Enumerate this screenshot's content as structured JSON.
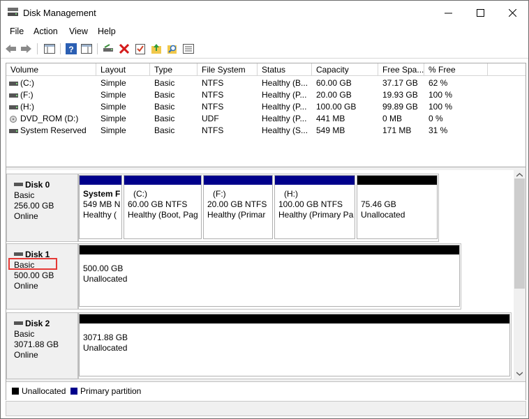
{
  "window": {
    "title": "Disk Management"
  },
  "menu": [
    "File",
    "Action",
    "View",
    "Help"
  ],
  "toolbar": {
    "icons": [
      "back-icon",
      "forward-icon",
      "console-tree-icon",
      "help-icon",
      "show-hide-icon",
      "connect-drive-icon",
      "delete-icon",
      "properties-icon",
      "up-folder-icon",
      "search-icon",
      "list-icon"
    ]
  },
  "volumes": {
    "columns": [
      "Volume",
      "Layout",
      "Type",
      "File System",
      "Status",
      "Capacity",
      "Free Spa...",
      "% Free"
    ],
    "rows": [
      [
        "(C:)",
        "Simple",
        "Basic",
        "NTFS",
        "Healthy (B...",
        "60.00 GB",
        "37.17 GB",
        "62 %"
      ],
      [
        "(F:)",
        "Simple",
        "Basic",
        "NTFS",
        "Healthy (P...",
        "20.00 GB",
        "19.93 GB",
        "100 %"
      ],
      [
        "(H:)",
        "Simple",
        "Basic",
        "NTFS",
        "Healthy (P...",
        "100.00 GB",
        "99.89 GB",
        "100 %"
      ],
      [
        "DVD_ROM (D:)",
        "Simple",
        "Basic",
        "UDF",
        "Healthy (P...",
        "441 MB",
        "0 MB",
        "0 %"
      ],
      [
        "System Reserved",
        "Simple",
        "Basic",
        "NTFS",
        "Healthy (S...",
        "549 MB",
        "171 MB",
        "31 %"
      ]
    ]
  },
  "disks": [
    {
      "name": "Disk 0",
      "type": "Basic",
      "size": "256.00 GB",
      "state": "Online",
      "partitions": [
        {
          "l1": "System F",
          "l2": "549 MB N",
          "l3": "Healthy (",
          "bold": true
        },
        {
          "l1": "(C:)",
          "l2": "60.00 GB NTFS",
          "l3": "Healthy (Boot, Pag"
        },
        {
          "l1": "(F:)",
          "l2": "20.00 GB NTFS",
          "l3": "Healthy (Primar"
        },
        {
          "l1": "(H:)",
          "l2": "100.00 GB NTFS",
          "l3": "Healthy (Primary Pa"
        },
        {
          "l1": "",
          "l2": "75.46 GB",
          "l3": "Unallocated"
        }
      ]
    },
    {
      "name": "Disk 1",
      "type": "Basic",
      "size": "500.00 GB",
      "state": "Online",
      "partitions": [
        {
          "l1": "",
          "l2": "500.00 GB",
          "l3": "Unallocated"
        }
      ]
    },
    {
      "name": "Disk 2",
      "type": "Basic",
      "size": "3071.88 GB",
      "state": "Online",
      "partitions": [
        {
          "l1": "",
          "l2": "3071.88 GB",
          "l3": "Unallocated"
        }
      ]
    }
  ],
  "legend": {
    "unallocated": "Unallocated",
    "primary": "Primary partition"
  },
  "colors": {
    "primary": "#00008b",
    "unallocated": "#000000",
    "highlight": "#e53935"
  }
}
